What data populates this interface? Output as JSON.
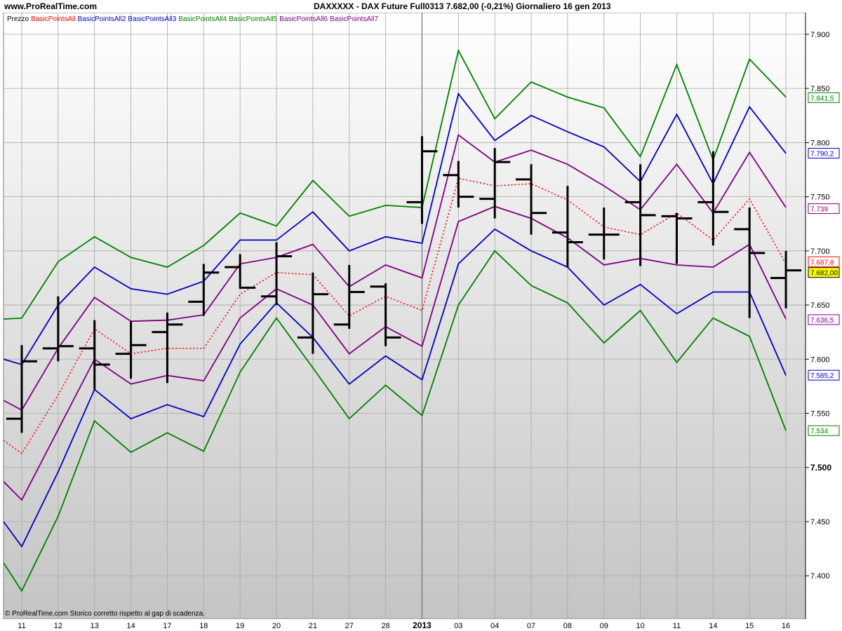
{
  "header": {
    "site": "www.ProRealTime.com",
    "title": "DAXXXXX - DAX Future Full0313   7.682,00 (-0,21%)   Giornaliero  16 gen 2013"
  },
  "footer": {
    "copyright": "© ProRealTime.com  Storico corretto rispetto al gap di scadenza."
  },
  "legend": [
    {
      "label": "Prezzo",
      "color": "#000000"
    },
    {
      "label": "BasicPointsAll",
      "color": "#ff0000"
    },
    {
      "label": "BasicPointsAll2",
      "color": "#0000c0"
    },
    {
      "label": "BasicPointsAll3",
      "color": "#0000c0"
    },
    {
      "label": "BasicPointsAll4",
      "color": "#008000"
    },
    {
      "label": "BasicPointsAll5",
      "color": "#008000"
    },
    {
      "label": "BasicPointsAll6",
      "color": "#800080"
    },
    {
      "label": "BasicPointsAll7",
      "color": "#800080"
    }
  ],
  "chart_data": {
    "type": "line",
    "x": [
      "11",
      "12",
      "13",
      "14",
      "17",
      "18",
      "19",
      "20",
      "21",
      "27",
      "28",
      "2013",
      "03",
      "04",
      "07",
      "08",
      "09",
      "10",
      "11",
      "14",
      "15",
      "16"
    ],
    "year_marker_index": 11,
    "ylim": [
      7360,
      7920
    ],
    "yticks": [
      7400,
      7450,
      7500,
      7550,
      7600,
      7650,
      7700,
      7750,
      7800,
      7850,
      7900
    ],
    "ytick_labels": [
      "7.400",
      "7.450",
      "7.500",
      "7.550",
      "7.600",
      "7.650",
      "7.700",
      "7.750",
      "7.800",
      "7.850",
      "7.900"
    ],
    "bold_ytick": 7500,
    "ohlc": [
      {
        "o": 7545,
        "h": 7613,
        "l": 7532,
        "c": 7598
      },
      {
        "o": 7610,
        "h": 7658,
        "l": 7598,
        "c": 7612
      },
      {
        "o": 7610,
        "h": 7636,
        "l": 7572,
        "c": 7595
      },
      {
        "o": 7605,
        "h": 7635,
        "l": 7582,
        "c": 7613
      },
      {
        "o": 7625,
        "h": 7643,
        "l": 7578,
        "c": 7632
      },
      {
        "o": 7653,
        "h": 7688,
        "l": 7640,
        "c": 7680
      },
      {
        "o": 7685,
        "h": 7697,
        "l": 7665,
        "c": 7666
      },
      {
        "o": 7658,
        "h": 7708,
        "l": 7650,
        "c": 7695
      },
      {
        "o": 7620,
        "h": 7680,
        "l": 7605,
        "c": 7660
      },
      {
        "o": 7632,
        "h": 7687,
        "l": 7628,
        "c": 7662
      },
      {
        "o": 7667,
        "h": 7670,
        "l": 7612,
        "c": 7620
      },
      {
        "o": 7745,
        "h": 7806,
        "l": 7725,
        "c": 7792
      },
      {
        "o": 7770,
        "h": 7783,
        "l": 7740,
        "c": 7750
      },
      {
        "o": 7748,
        "h": 7795,
        "l": 7730,
        "c": 7782
      },
      {
        "o": 7766,
        "h": 7780,
        "l": 7715,
        "c": 7735
      },
      {
        "o": 7717,
        "h": 7760,
        "l": 7685,
        "c": 7708
      },
      {
        "o": 7715,
        "h": 7740,
        "l": 7692,
        "c": 7715
      },
      {
        "o": 7745,
        "h": 7780,
        "l": 7686,
        "c": 7733
      },
      {
        "o": 7732,
        "h": 7735,
        "l": 7688,
        "c": 7730
      },
      {
        "o": 7745,
        "h": 7792,
        "l": 7705,
        "c": 7736
      },
      {
        "o": 7720,
        "h": 7740,
        "l": 7638,
        "c": 7698
      },
      {
        "o": 7675,
        "h": 7700,
        "l": 7647,
        "c": 7682
      }
    ],
    "series": [
      {
        "key": "pivot",
        "color": "#ff0000",
        "dash": true,
        "values": [
          7525,
          7513,
          7567,
          7628,
          7605,
          7610,
          7610,
          7660,
          7680,
          7678,
          7640,
          7658,
          7645,
          7767,
          7760,
          7762,
          7747,
          7722,
          7715,
          7735,
          7710,
          7748,
          7688
        ]
      },
      {
        "key": "band1_upper",
        "color": "#800080",
        "values": [
          7562,
          7553,
          7610,
          7657,
          7635,
          7636,
          7641,
          7688,
          7694,
          7706,
          7667,
          7687,
          7675,
          7807,
          7782,
          7793,
          7780,
          7760,
          7738,
          7780,
          7735,
          7791,
          7740
        ]
      },
      {
        "key": "band1_lower",
        "color": "#800080",
        "values": [
          7487,
          7470,
          7535,
          7600,
          7577,
          7585,
          7580,
          7638,
          7665,
          7650,
          7605,
          7630,
          7612,
          7727,
          7741,
          7730,
          7712,
          7687,
          7693,
          7687,
          7685,
          7706,
          7637
        ]
      },
      {
        "key": "band2_upper",
        "color": "#0000c0",
        "values": [
          7600,
          7595,
          7650,
          7685,
          7665,
          7660,
          7672,
          7710,
          7710,
          7736,
          7700,
          7713,
          7707,
          7845,
          7802,
          7825,
          7810,
          7796,
          7764,
          7826,
          7762,
          7833,
          7790
        ]
      },
      {
        "key": "band2_lower",
        "color": "#0000c0",
        "values": [
          7450,
          7427,
          7496,
          7572,
          7545,
          7558,
          7547,
          7614,
          7652,
          7620,
          7577,
          7603,
          7581,
          7688,
          7720,
          7700,
          7685,
          7650,
          7669,
          7642,
          7662,
          7662,
          7585
        ]
      },
      {
        "key": "band3_upper",
        "color": "#008000",
        "values": [
          7637,
          7638,
          7690,
          7713,
          7694,
          7685,
          7705,
          7735,
          7723,
          7765,
          7732,
          7742,
          7740,
          7885,
          7822,
          7856,
          7842,
          7832,
          7787,
          7872,
          7784,
          7877,
          7842
        ]
      },
      {
        "key": "band3_lower",
        "color": "#008000",
        "values": [
          7412,
          7386,
          7455,
          7543,
          7514,
          7532,
          7515,
          7588,
          7638,
          7592,
          7545,
          7576,
          7548,
          7650,
          7700,
          7668,
          7652,
          7615,
          7645,
          7597,
          7638,
          7621,
          7534
        ]
      }
    ],
    "price_labels": [
      {
        "text": "7.841,5",
        "value": 7841.5,
        "color": "#008000",
        "bg": "#ffffff"
      },
      {
        "text": "7.790,2",
        "value": 7790.2,
        "color": "#0000c0",
        "bg": "#ffffff"
      },
      {
        "text": "7.739",
        "value": 7739,
        "color": "#800080",
        "bg": "#ffffff"
      },
      {
        "text": "7.687,8",
        "value": 7690,
        "color": "#ff0000",
        "bg": "#ffffff"
      },
      {
        "text": "7.682,00",
        "value": 7680,
        "color": "#000000",
        "bg": "#ffff00"
      },
      {
        "text": "7.636,5",
        "value": 7636.5,
        "color": "#800080",
        "bg": "#ffffff"
      },
      {
        "text": "7.585,2",
        "value": 7585.2,
        "color": "#0000c0",
        "bg": "#ffffff"
      },
      {
        "text": "7.534",
        "value": 7534,
        "color": "#008000",
        "bg": "#ffffff"
      }
    ]
  }
}
